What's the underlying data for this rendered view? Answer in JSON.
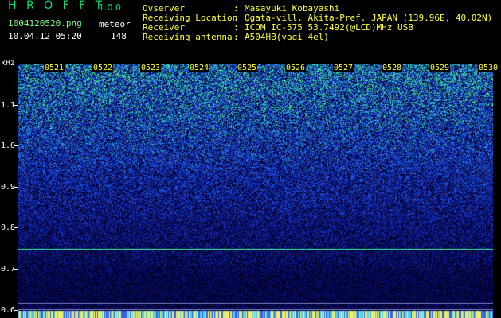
{
  "header": {
    "app_title": "H R O F F T",
    "app_version": "1.0.0",
    "file_name": "1004120520.png",
    "meteor_label": "meteor",
    "date_time": "10.04.12 05:20",
    "meteor_count": "148"
  },
  "info": [
    {
      "key": "Ovserver",
      "sep": ":",
      "value": "Masayuki Kobayashi"
    },
    {
      "key": "Receiving Location",
      "sep": ":",
      "value": "Ogata-vill. Akita-Pref. JAPAN (139.96E, 40.02N)"
    },
    {
      "key": "Receiver",
      "sep": ":",
      "value": "ICOM IC-575 53.7492(@LCD)MHz USB"
    },
    {
      "key": "Receiving antenna",
      "sep": ":",
      "value": "A504HB(yagi 4el)"
    }
  ],
  "frequency_axis": {
    "unit": "kHz",
    "ticks": [
      "1.1",
      "1.0",
      "0.9",
      "0.8",
      "0.7",
      "0.6"
    ],
    "tick_values": [
      1.1,
      1.0,
      0.9,
      0.8,
      0.7,
      0.6
    ],
    "range": [
      0.58,
      1.2
    ]
  },
  "time_axis": {
    "labels": [
      "0521",
      "0522",
      "0523",
      "0524",
      "0525",
      "0526",
      "0527",
      "0528",
      "0529",
      "0530"
    ]
  },
  "colors": {
    "background": "#000000",
    "title_green": "#00e070",
    "info_yellow": "#ffff40",
    "signal_line": "#3cff8c",
    "noise_deep": "#0a0a6e",
    "noise_mid": "#2a50e0",
    "noise_hot": "#2ee08a"
  }
}
